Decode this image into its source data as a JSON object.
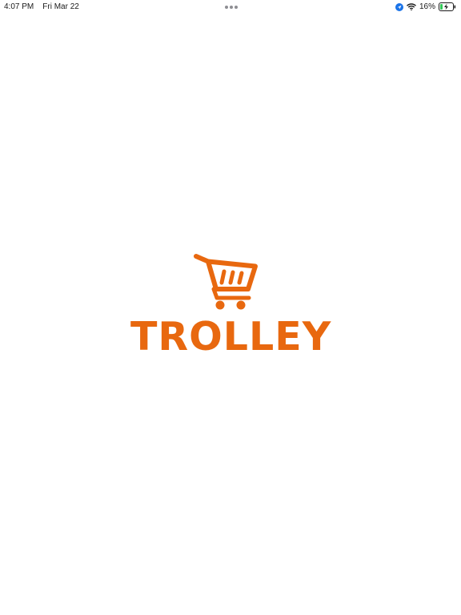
{
  "status_bar": {
    "time": "4:07 PM",
    "date": "Fri Mar 22",
    "battery": "16%",
    "icons": [
      "location-icon",
      "wifi-icon",
      "battery-charging-icon",
      "multitask-dots-icon"
    ]
  },
  "splash": {
    "brand_name": "TROLLEY",
    "logo_icon": "shopping-cart-icon",
    "brand_color": "#e8680f",
    "background_color": "#ffffff"
  }
}
